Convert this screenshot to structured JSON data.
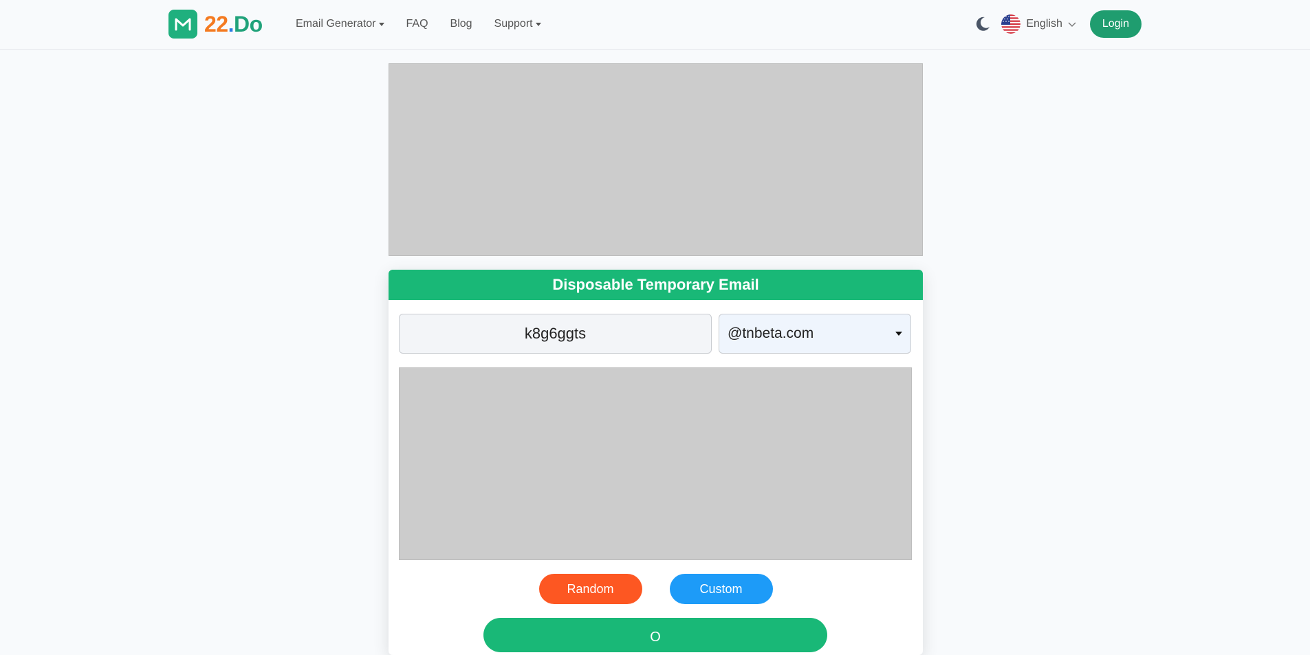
{
  "header": {
    "logo": {
      "num": "22",
      "dot": ".",
      "do": "Do"
    },
    "nav": [
      {
        "label": "Email Generator",
        "dropdown": true
      },
      {
        "label": "FAQ",
        "dropdown": false
      },
      {
        "label": "Blog",
        "dropdown": false
      },
      {
        "label": "Support",
        "dropdown": true
      }
    ],
    "language": "English",
    "login_label": "Login",
    "icons": {
      "theme": "moon-icon",
      "flag": "us-flag-icon",
      "language_chevron": "chevron-down-icon",
      "logo": "mail-m-icon"
    }
  },
  "card": {
    "title": "Disposable Temporary Email",
    "email_name": "k8g6ggts",
    "domain": "@tnbeta.com",
    "random_label": "Random",
    "custom_label": "Custom",
    "open_label": "O"
  },
  "colors": {
    "brand_green": "#19b877",
    "logo_orange": "#f47a20",
    "logo_blue": "#2a7be4",
    "random_orange": "#fd5722",
    "custom_blue": "#1d9bf8"
  }
}
